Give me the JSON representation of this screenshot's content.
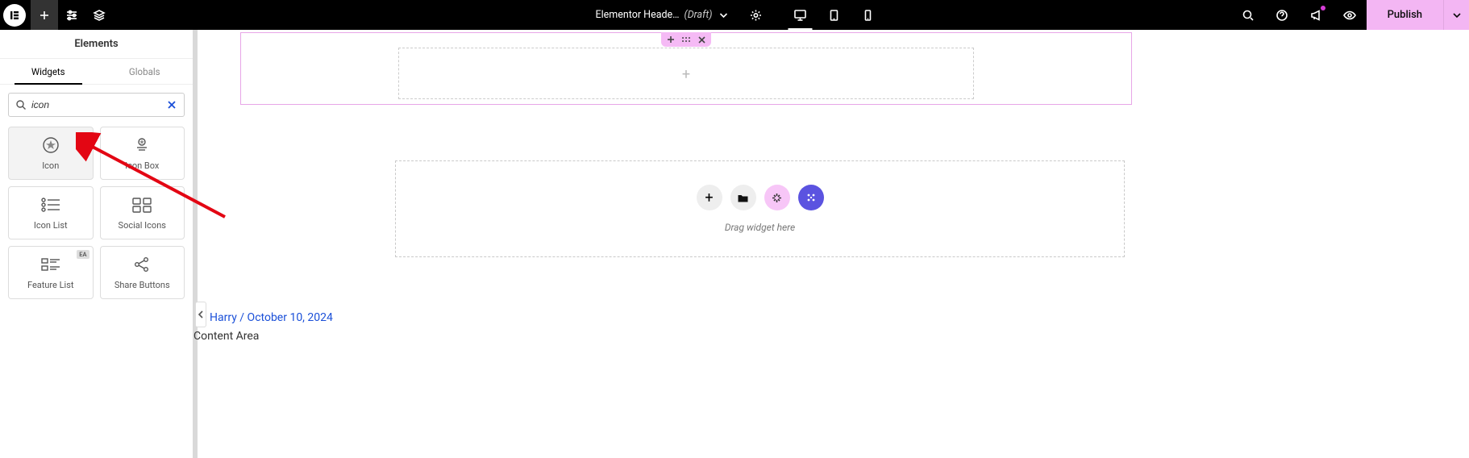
{
  "topbar": {
    "document_title": "Elementor Heade…",
    "document_status": "(Draft)",
    "publish_label": "Publish"
  },
  "sidebar": {
    "title": "Elements",
    "tabs": {
      "widgets": "Widgets",
      "globals": "Globals"
    },
    "search_value": "icon",
    "widgets": [
      {
        "label": "Icon"
      },
      {
        "label": "Icon Box"
      },
      {
        "label": "Icon List"
      },
      {
        "label": "Social Icons"
      },
      {
        "label": "Feature List",
        "badge": "EA"
      },
      {
        "label": "Share Buttons"
      }
    ]
  },
  "canvas": {
    "drop_label": "Drag widget here",
    "byline": "Harry / October 10, 2024",
    "content_area": "Content Area"
  }
}
